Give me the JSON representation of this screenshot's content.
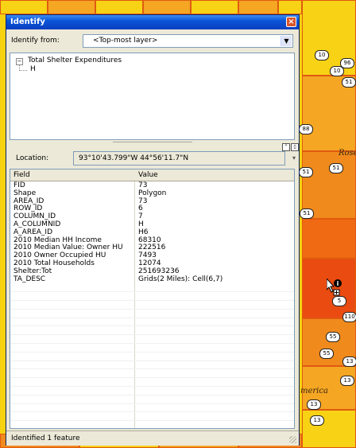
{
  "window": {
    "title": "Identify",
    "close_symbol": "×"
  },
  "identify_from": {
    "label": "Identify from:",
    "value": "<Top-most layer>"
  },
  "tree": {
    "layer": "Total Shelter Expenditures",
    "feature": "H"
  },
  "location": {
    "label": "Location:",
    "value": "93°10'43.799\"W  44°56'11.7\"N"
  },
  "table": {
    "columns": [
      "Field",
      "Value"
    ],
    "rows": [
      {
        "field": "FID",
        "value": "73"
      },
      {
        "field": "Shape",
        "value": "Polygon"
      },
      {
        "field": "AREA_ID",
        "value": "73"
      },
      {
        "field": "ROW_ID",
        "value": "6"
      },
      {
        "field": "COLUMN_ID",
        "value": "7"
      },
      {
        "field": "A_COLUMNID",
        "value": "H"
      },
      {
        "field": "A_AREA_ID",
        "value": "H6"
      },
      {
        "field": "2010 Median HH Income",
        "value": "68310"
      },
      {
        "field": "2010 Median Value: Owner HU",
        "value": "222516"
      },
      {
        "field": "2010 Owner Occupied HU",
        "value": "7493"
      },
      {
        "field": "2010 Total Households",
        "value": "12074"
      },
      {
        "field": "Shelter:Tot",
        "value": "251693236"
      },
      {
        "field": "TA_DESC",
        "value": "Grids(2 Miles): Cell(6,7)"
      }
    ]
  },
  "status": {
    "text": "Identified 1 feature"
  },
  "map": {
    "labels": [
      "Rose",
      "merica"
    ],
    "shields": [
      "10",
      "10",
      "96",
      "51",
      "88",
      "51",
      "51",
      "51",
      "5",
      "55",
      "110",
      "55",
      "13",
      "13"
    ],
    "colors": {
      "yellow": "#f7d215",
      "light_orange": "#f5a623",
      "orange": "#f08a1c",
      "dark_orange": "#ef6a12",
      "red_orange": "#ea4b10",
      "grid_line": "#e05a10"
    }
  }
}
